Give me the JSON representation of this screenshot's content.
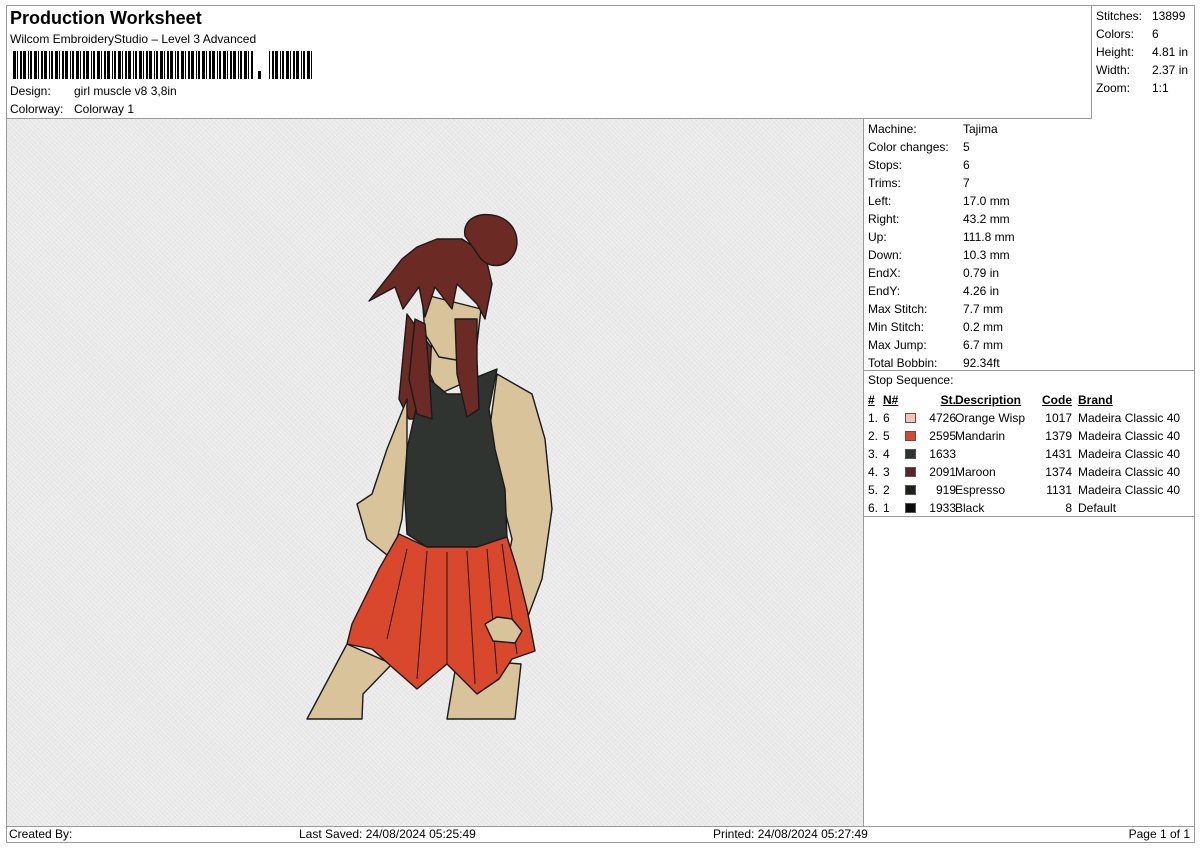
{
  "header": {
    "title": "Production Worksheet",
    "subtitle": "Wilcom EmbroideryStudio – Level 3 Advanced",
    "design_label": "Design:",
    "design_value": "girl muscle v8 3,8in",
    "colorway_label": "Colorway:",
    "colorway_value": "Colorway 1"
  },
  "summary": [
    {
      "label": "Stitches:",
      "value": "13899"
    },
    {
      "label": "Colors:",
      "value": "6"
    },
    {
      "label": "Height:",
      "value": "4.81 in"
    },
    {
      "label": "Width:",
      "value": "2.37 in"
    },
    {
      "label": "Zoom:",
      "value": "1:1"
    }
  ],
  "machine_info": [
    {
      "label": "Machine:",
      "value": "Tajima"
    },
    {
      "label": "Color changes:",
      "value": "5"
    },
    {
      "label": "Stops:",
      "value": "6"
    },
    {
      "label": "Trims:",
      "value": "7"
    },
    {
      "label": "Left:",
      "value": "17.0 mm"
    },
    {
      "label": "Right:",
      "value": "43.2 mm"
    },
    {
      "label": "Up:",
      "value": "111.8 mm"
    },
    {
      "label": "Down:",
      "value": "10.3 mm"
    },
    {
      "label": "EndX:",
      "value": "0.79 in"
    },
    {
      "label": "EndY:",
      "value": "4.26 in"
    },
    {
      "label": "Max Stitch:",
      "value": "7.7 mm"
    },
    {
      "label": "Min Stitch:",
      "value": "0.2 mm"
    },
    {
      "label": "Max Jump:",
      "value": "6.7 mm"
    },
    {
      "label": "Total Bobbin:",
      "value": "92.34ft"
    }
  ],
  "stop_sequence": {
    "title": "Stop Sequence:",
    "columns": {
      "num": "#",
      "n": "N#",
      "st": "St.",
      "desc": "Description",
      "code": "Code",
      "brand": "Brand"
    },
    "rows": [
      {
        "num": "1.",
        "n": "6",
        "color": "#f6c3b4",
        "st": "4726",
        "desc": "Orange Wisp",
        "code": "1017",
        "brand": "Madeira Classic 40"
      },
      {
        "num": "2.",
        "n": "5",
        "color": "#d9472c",
        "st": "2595",
        "desc": "Mandarin",
        "code": "1379",
        "brand": "Madeira Classic 40"
      },
      {
        "num": "3.",
        "n": "4",
        "color": "#2f3430",
        "st": "1633",
        "desc": "",
        "code": "1431",
        "brand": "Madeira Classic 40"
      },
      {
        "num": "4.",
        "n": "3",
        "color": "#5c2424",
        "st": "2091",
        "desc": "Maroon",
        "code": "1374",
        "brand": "Madeira Classic 40"
      },
      {
        "num": "5.",
        "n": "2",
        "color": "#1f1f1b",
        "st": "919",
        "desc": "Espresso",
        "code": "1131",
        "brand": "Madeira Classic 40"
      },
      {
        "num": "6.",
        "n": "1",
        "color": "#0a0a0a",
        "st": "1933",
        "desc": "Black",
        "code": "8",
        "brand": "Default"
      }
    ]
  },
  "footer": {
    "created_by": "Created By:",
    "last_saved": "Last Saved: 24/08/2024 05:25:49",
    "printed": "Printed: 24/08/2024 05:27:49",
    "page": "Page 1 of 1"
  },
  "design_colors": {
    "skin": "#d8c39a",
    "hair": "#6b2a24",
    "top": "#2f3430",
    "skirt": "#d9472c",
    "outline": "#1a1a1a"
  }
}
